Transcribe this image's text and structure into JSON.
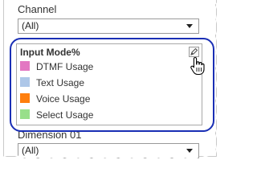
{
  "channel": {
    "label": "Channel",
    "selected": "(All)"
  },
  "legend": {
    "title": "Input Mode%",
    "items": [
      {
        "label": "DTMF Usage",
        "color": "#e377c2"
      },
      {
        "label": "Text Usage",
        "color": "#aec7e8"
      },
      {
        "label": "Voice Usage",
        "color": "#ff7f0e"
      },
      {
        "label": "Select Usage",
        "color": "#98df8a"
      }
    ]
  },
  "dimension": {
    "label": "Dimension 01",
    "selected": "(All)"
  },
  "icons": {
    "edit": "edit-pencil-icon",
    "cursor": "hand-pointer-icon",
    "dropdown": "chevron-down-icon"
  },
  "highlight_color": "#1a2fb5"
}
